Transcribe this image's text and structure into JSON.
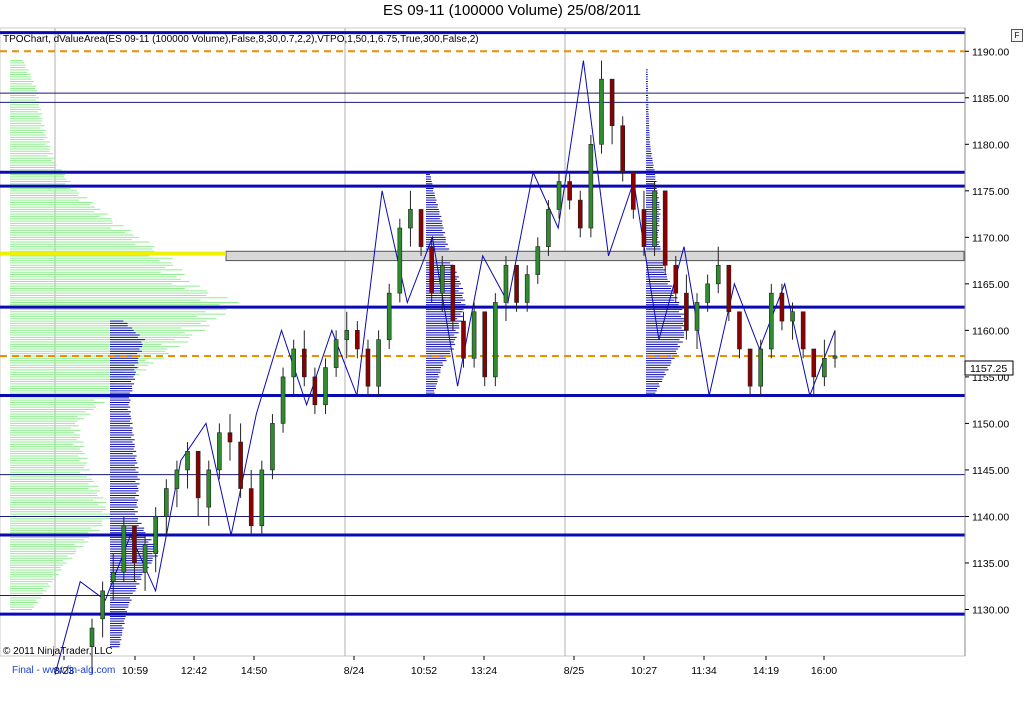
{
  "title": "ES 09-11 (100000 Volume)  25/08/2011",
  "indicator_label": "TPOChart, dValueArea(ES 09-11 (100000 Volume),False,8,30,0.7,2,2),VTPO,1,50,1,6.75,True,300,False,2)",
  "f_button": "F",
  "copyright": "© 2011 NinjaTrader, LLC",
  "footer_link": "Final - www.fin-alg.com",
  "price_marker": "1157.25",
  "colors": {
    "value_line": "#0a0ab4",
    "dashed": "#f08c00",
    "up_candle": "#2e8b2e",
    "down_candle": "#8b0000",
    "profile_green": "#90ee90",
    "profile_blue": "#0a0ab4",
    "poc_yellow": "#f0f000",
    "grid": "#b0b0b0",
    "zigzag": "#0a0ab4"
  },
  "chart_data": {
    "type": "candlestick",
    "ylim": [
      1125.0,
      1192.5
    ],
    "y_ticks": [
      "1130.00",
      "1135.00",
      "1140.00",
      "1145.00",
      "1150.00",
      "1155.00",
      "1160.00",
      "1165.00",
      "1170.00",
      "1175.00",
      "1180.00",
      "1185.00",
      "1190.00"
    ],
    "x_labels": [
      "8/23",
      "10:59",
      "12:42",
      "14:50",
      "8/24",
      "10:52",
      "13:24",
      "8/25",
      "10:27",
      "11:34",
      "14:19",
      "16:00"
    ],
    "thick_levels": [
      1192.0,
      1177.0,
      1175.5,
      1162.5,
      1153.0,
      1138.0,
      1129.5
    ],
    "thin_levels": [
      1185.5,
      1184.5,
      1144.5,
      1140.0,
      1131.5
    ],
    "dashed_levels": [
      1190.0,
      1157.25
    ],
    "poc_level": 1168.25,
    "poc_band": [
      1167.5,
      1168.5
    ],
    "last_price": 1157.25,
    "candles": [
      [
        1126,
        1129,
        1123,
        1128
      ],
      [
        1129,
        1133,
        1127,
        1132
      ],
      [
        1133,
        1136,
        1131,
        1134
      ],
      [
        1134,
        1140,
        1133,
        1139
      ],
      [
        1139,
        1138,
        1133,
        1135
      ],
      [
        1134,
        1138,
        1132,
        1137
      ],
      [
        1136,
        1141,
        1134,
        1140
      ],
      [
        1140,
        1144,
        1138,
        1143
      ],
      [
        1143,
        1146,
        1141,
        1145
      ],
      [
        1145,
        1148,
        1143,
        1147
      ],
      [
        1147,
        1145,
        1140,
        1142
      ],
      [
        1141,
        1146,
        1139,
        1145
      ],
      [
        1145,
        1150,
        1144,
        1149
      ],
      [
        1149,
        1151,
        1146,
        1148
      ],
      [
        1148,
        1150,
        1142,
        1143
      ],
      [
        1143,
        1145,
        1138,
        1139
      ],
      [
        1139,
        1146,
        1138,
        1145
      ],
      [
        1145,
        1151,
        1144,
        1150
      ],
      [
        1150,
        1156,
        1149,
        1155
      ],
      [
        1155,
        1159,
        1153,
        1158
      ],
      [
        1158,
        1160,
        1154,
        1155
      ],
      [
        1155,
        1156,
        1151,
        1152
      ],
      [
        1152,
        1157,
        1151,
        1156
      ],
      [
        1156,
        1160,
        1155,
        1159
      ],
      [
        1159,
        1162,
        1157,
        1160
      ],
      [
        1160,
        1161,
        1157,
        1158
      ],
      [
        1158,
        1159,
        1153,
        1154
      ],
      [
        1154,
        1160,
        1153,
        1159
      ],
      [
        1159,
        1165,
        1158,
        1164
      ],
      [
        1164,
        1172,
        1163,
        1171
      ],
      [
        1171,
        1175,
        1169,
        1173
      ],
      [
        1173,
        1172,
        1168,
        1169
      ],
      [
        1169,
        1170,
        1163,
        1164
      ],
      [
        1164,
        1168,
        1162,
        1167
      ],
      [
        1167,
        1166,
        1160,
        1161
      ],
      [
        1161,
        1162,
        1156,
        1157
      ],
      [
        1157,
        1163,
        1156,
        1162
      ],
      [
        1162,
        1161,
        1154,
        1155
      ],
      [
        1155,
        1164,
        1154,
        1163
      ],
      [
        1163,
        1168,
        1161,
        1167
      ],
      [
        1167,
        1166,
        1162,
        1163
      ],
      [
        1163,
        1167,
        1162,
        1166
      ],
      [
        1166,
        1170,
        1165,
        1169
      ],
      [
        1169,
        1174,
        1168,
        1173
      ],
      [
        1173,
        1177,
        1172,
        1176
      ],
      [
        1176,
        1177,
        1173,
        1174
      ],
      [
        1174,
        1175,
        1170,
        1171
      ],
      [
        1171,
        1181,
        1170,
        1180
      ],
      [
        1180,
        1189,
        1179,
        1187
      ],
      [
        1187,
        1186,
        1180,
        1182
      ],
      [
        1182,
        1183,
        1176,
        1177
      ],
      [
        1177,
        1176,
        1172,
        1173
      ],
      [
        1173,
        1175,
        1168,
        1169
      ],
      [
        1169,
        1176,
        1168,
        1175
      ],
      [
        1175,
        1174,
        1166,
        1167
      ],
      [
        1167,
        1168,
        1163,
        1164
      ],
      [
        1164,
        1166,
        1159,
        1160
      ],
      [
        1160,
        1164,
        1158,
        1163
      ],
      [
        1163,
        1166,
        1162,
        1165
      ],
      [
        1165,
        1169,
        1164,
        1167
      ],
      [
        1167,
        1166,
        1161,
        1162
      ],
      [
        1162,
        1161,
        1157,
        1158
      ],
      [
        1158,
        1157,
        1153,
        1154
      ],
      [
        1154,
        1159,
        1153,
        1158
      ],
      [
        1158,
        1165,
        1157,
        1164
      ],
      [
        1164,
        1165,
        1160,
        1161
      ],
      [
        1161,
        1163,
        1159,
        1162
      ],
      [
        1162,
        1161,
        1157,
        1158
      ],
      [
        1158,
        1157,
        1153,
        1155
      ],
      [
        1155,
        1159,
        1154,
        1157
      ],
      [
        1157,
        1160,
        1156,
        1157.25
      ]
    ],
    "zigzag": [
      1123,
      1133,
      1131,
      1138,
      1132,
      1146,
      1150,
      1138,
      1151,
      1160,
      1152,
      1160,
      1153,
      1175,
      1163,
      1170,
      1154,
      1168,
      1163,
      1177,
      1171,
      1189,
      1168,
      1176,
      1159,
      1169,
      1153,
      1165,
      1158,
      1165,
      1153,
      1160
    ],
    "profiles": [
      {
        "name": "composite",
        "color": "green",
        "levels": [
          [
            1130,
            0.1
          ],
          [
            1135,
            0.25
          ],
          [
            1140,
            0.45
          ],
          [
            1145,
            0.35
          ],
          [
            1150,
            0.3
          ],
          [
            1155,
            0.55
          ],
          [
            1160,
            0.85
          ],
          [
            1163,
            1.0
          ],
          [
            1165,
            0.8
          ],
          [
            1168,
            0.7
          ],
          [
            1172,
            0.45
          ],
          [
            1175,
            0.3
          ],
          [
            1178,
            0.2
          ],
          [
            1182,
            0.15
          ],
          [
            1186,
            0.12
          ],
          [
            1189,
            0.06
          ]
        ]
      },
      {
        "name": "day1",
        "color": "blue",
        "levels": [
          [
            1126,
            0.2
          ],
          [
            1130,
            0.35
          ],
          [
            1134,
            0.7
          ],
          [
            1136,
            1.0
          ],
          [
            1140,
            0.55
          ],
          [
            1144,
            0.6
          ],
          [
            1148,
            0.5
          ],
          [
            1152,
            0.4
          ],
          [
            1156,
            0.55
          ],
          [
            1159,
            0.7
          ],
          [
            1161,
            0.3
          ]
        ]
      },
      {
        "name": "day2",
        "color": "blue",
        "levels": [
          [
            1153,
            0.2
          ],
          [
            1156,
            0.4
          ],
          [
            1158,
            0.7
          ],
          [
            1161,
            0.9
          ],
          [
            1163,
            1.0
          ],
          [
            1165,
            0.9
          ],
          [
            1167,
            0.7
          ],
          [
            1170,
            0.5
          ],
          [
            1172,
            0.4
          ],
          [
            1175,
            0.2
          ],
          [
            1177,
            0.1
          ]
        ]
      },
      {
        "name": "day3",
        "color": "blue",
        "levels": [
          [
            1153,
            0.2
          ],
          [
            1155,
            0.45
          ],
          [
            1158,
            0.8
          ],
          [
            1160,
            1.0
          ],
          [
            1162,
            0.9
          ],
          [
            1164,
            0.7
          ],
          [
            1166,
            0.5
          ],
          [
            1168,
            0.4
          ],
          [
            1170,
            0.3
          ],
          [
            1173,
            0.35
          ],
          [
            1176,
            0.25
          ],
          [
            1180,
            0.1
          ],
          [
            1184,
            0.06
          ],
          [
            1188,
            0.04
          ]
        ]
      }
    ]
  }
}
